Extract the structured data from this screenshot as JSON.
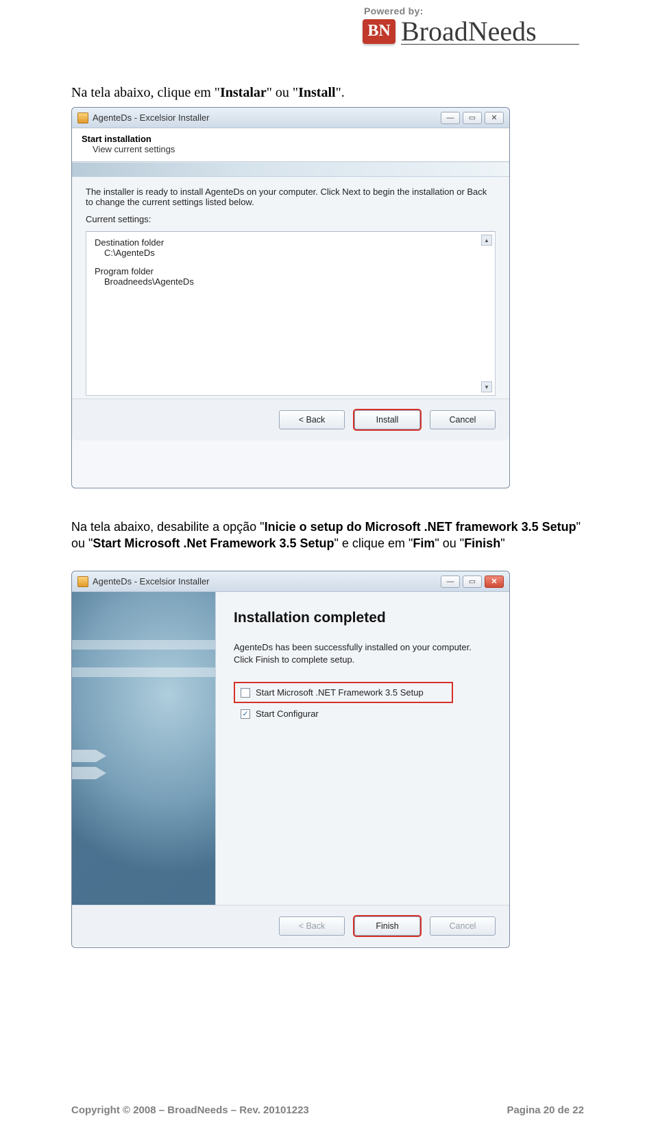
{
  "header": {
    "powered": "Powered by:",
    "badge": "BN",
    "brand": "BroadNeeds"
  },
  "para1": {
    "pre": "Na tela abaixo, clique em \"",
    "b1": "Instalar",
    "mid": "\" ou \"",
    "b2": "Install",
    "post": "\"."
  },
  "win1": {
    "title": "AgenteDs - Excelsior Installer",
    "head1": "Start installation",
    "head2": "View current settings",
    "ready": "The installer is ready to install AgenteDs  on your computer. Click Next to begin the installation or Back to change the current settings listed below.",
    "current": "Current settings:",
    "dest_label": "Destination folder",
    "dest_value": "C:\\AgenteDs",
    "prog_label": "Program folder",
    "prog_value": "Broadneeds\\AgenteDs",
    "btn_back": "< Back",
    "btn_install": "Install",
    "btn_cancel": "Cancel"
  },
  "para2": {
    "t1": "Na tela abaixo, desabilite a opção \"",
    "b1": "Inicie o setup do Microsoft .NET framework 3.5 Setup",
    "t2": "\" ou \"",
    "b2": "Start Microsoft .Net Framework 3.5 Setup",
    "t3": "\" e clique em \"",
    "b3": "Fim",
    "t4": "\" ou \"",
    "b4": "Finish",
    "t5": "\""
  },
  "win2": {
    "title": "AgenteDs - Excelsior Installer",
    "heading": "Installation completed",
    "desc": "AgenteDs  has been successfully installed on your computer. Click Finish to complete setup.",
    "chk1": "Start Microsoft .NET Framework 3.5 Setup",
    "chk2": "Start Configurar",
    "btn_back": "< Back",
    "btn_finish": "Finish",
    "btn_cancel": "Cancel"
  },
  "footer": {
    "left": "Copyright © 2008 – BroadNeeds – Rev. 20101223",
    "right": "Pagina 20 de 22"
  },
  "glyph": {
    "min": "—",
    "max": "▭",
    "close": "✕",
    "up": "▲",
    "down": "▼",
    "check": "✓"
  }
}
